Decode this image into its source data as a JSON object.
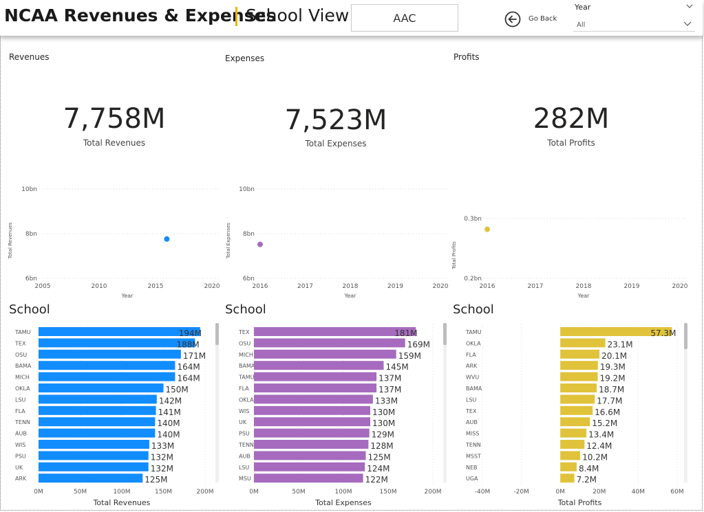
{
  "header": {
    "title": "NCAA Revenues & Expenses",
    "subtitle": "School View",
    "conference": "AAC",
    "back_label": "Go Back",
    "year_slicer_title": "Year",
    "year_slicer_value": "All",
    "accent_color": "#E8B600"
  },
  "sections": {
    "revenues_label": "Revenues",
    "expenses_label": "Expenses",
    "profits_label": "Profits"
  },
  "kpis": {
    "revenues": {
      "value": "7,758M",
      "label": "Total Revenues"
    },
    "expenses": {
      "value": "7,523M",
      "label": "Total Expenses"
    },
    "profits": {
      "value": "282M",
      "label": "Total Profits"
    }
  },
  "colors": {
    "revenues": "#118DFF",
    "expenses": "#A66BBE",
    "profits": "#E0C33A"
  },
  "icons": {
    "back": "arrow-left-circle-icon",
    "dropdown": "chevron-down-icon"
  },
  "chart_data": [
    {
      "id": "rev-trend",
      "type": "scatter",
      "xlabel": "Year",
      "ylabel": "Total Revenues",
      "xlim": [
        2005,
        2020
      ],
      "xticks": [
        "2005",
        "2010",
        "2015",
        "2020"
      ],
      "ylim": [
        6,
        10
      ],
      "yticks": [
        {
          "v": 6,
          "t": "6bn"
        },
        {
          "v": 8,
          "t": "8bn"
        },
        {
          "v": 10,
          "t": "10bn"
        }
      ],
      "points": [
        {
          "x": 2016,
          "y": 7.76
        }
      ],
      "grid": true
    },
    {
      "id": "exp-trend",
      "type": "scatter",
      "xlabel": "Year",
      "ylabel": "Total Expenses",
      "xlim": [
        2016,
        2020
      ],
      "xticks": [
        "2016",
        "2017",
        "2018",
        "2019",
        "2020"
      ],
      "ylim": [
        6,
        10
      ],
      "yticks": [
        {
          "v": 6,
          "t": "6bn"
        },
        {
          "v": 8,
          "t": "8bn"
        },
        {
          "v": 10,
          "t": "10bn"
        }
      ],
      "points": [
        {
          "x": 2016,
          "y": 7.52
        }
      ],
      "grid": true
    },
    {
      "id": "prof-trend",
      "type": "scatter",
      "xlabel": "Year",
      "ylabel": "Total Profits",
      "xlim": [
        2016,
        2020
      ],
      "xticks": [
        "2016",
        "2017",
        "2018",
        "2019",
        "2020"
      ],
      "ylim": [
        0.2,
        0.3
      ],
      "yticks": [
        {
          "v": 0.2,
          "t": "0.2bn"
        },
        {
          "v": 0.3,
          "t": "0.3bn"
        }
      ],
      "points": [
        {
          "x": 2016,
          "y": 0.282
        }
      ],
      "grid": true
    },
    {
      "id": "rev-bars",
      "type": "bar",
      "title": "School",
      "xlabel": "Total Revenues",
      "xlim": [
        0,
        200
      ],
      "xticks": [
        {
          "v": 0,
          "t": "0M"
        },
        {
          "v": 50,
          "t": "50M"
        },
        {
          "v": 100,
          "t": "100M"
        },
        {
          "v": 150,
          "t": "150M"
        },
        {
          "v": 200,
          "t": "200M"
        }
      ],
      "categories": [
        "TAMU",
        "TEX",
        "OSU",
        "BAMA",
        "MICH",
        "OKLA",
        "LSU",
        "FLA",
        "TENN",
        "AUB",
        "WIS",
        "PSU",
        "UK",
        "ARK"
      ],
      "values": [
        194,
        188,
        171,
        164,
        164,
        150,
        142,
        141,
        140,
        140,
        133,
        132,
        132,
        125
      ],
      "labels": [
        "194M",
        "188M",
        "171M",
        "164M",
        "164M",
        "150M",
        "142M",
        "141M",
        "140M",
        "140M",
        "133M",
        "132M",
        "132M",
        "125M"
      ]
    },
    {
      "id": "exp-bars",
      "type": "bar",
      "title": "School",
      "xlabel": "Total Expenses",
      "xlim": [
        0,
        200
      ],
      "xticks": [
        {
          "v": 0,
          "t": "0M"
        },
        {
          "v": 50,
          "t": "50M"
        },
        {
          "v": 100,
          "t": "100M"
        },
        {
          "v": 150,
          "t": "150M"
        },
        {
          "v": 200,
          "t": "200M"
        }
      ],
      "categories": [
        "TEX",
        "OSU",
        "MICH",
        "BAMA",
        "TAMU",
        "FLA",
        "OKLA",
        "WIS",
        "UK",
        "PSU",
        "TENN",
        "AUB",
        "LSU",
        "MSU"
      ],
      "values": [
        181,
        169,
        159,
        145,
        137,
        137,
        133,
        130,
        130,
        129,
        128,
        125,
        124,
        122
      ],
      "labels": [
        "181M",
        "169M",
        "159M",
        "145M",
        "137M",
        "137M",
        "133M",
        "130M",
        "130M",
        "129M",
        "128M",
        "125M",
        "124M",
        "122M"
      ]
    },
    {
      "id": "prof-bars",
      "type": "bar",
      "title": "School",
      "xlabel": "Total Profits",
      "xlim": [
        -40,
        60
      ],
      "xticks": [
        {
          "v": -40,
          "t": "-40M"
        },
        {
          "v": -20,
          "t": "-20M"
        },
        {
          "v": 0,
          "t": "0M"
        },
        {
          "v": 20,
          "t": "20M"
        },
        {
          "v": 40,
          "t": "40M"
        },
        {
          "v": 60,
          "t": "60M"
        }
      ],
      "categories": [
        "TAMU",
        "OKLA",
        "FLA",
        "ARK",
        "WVU",
        "BAMA",
        "LSU",
        "TEX",
        "AUB",
        "MISS",
        "TENN",
        "MSST",
        "NEB",
        "UGA"
      ],
      "values": [
        57.3,
        23.1,
        20.1,
        19.3,
        19.2,
        18.7,
        17.7,
        16.6,
        15.2,
        13.4,
        12.4,
        10.2,
        8.4,
        7.2
      ],
      "labels": [
        "57.3M",
        "23.1M",
        "20.1M",
        "19.3M",
        "19.2M",
        "18.7M",
        "17.7M",
        "16.6M",
        "15.2M",
        "13.4M",
        "12.4M",
        "10.2M",
        "8.4M",
        "7.2M"
      ]
    }
  ]
}
